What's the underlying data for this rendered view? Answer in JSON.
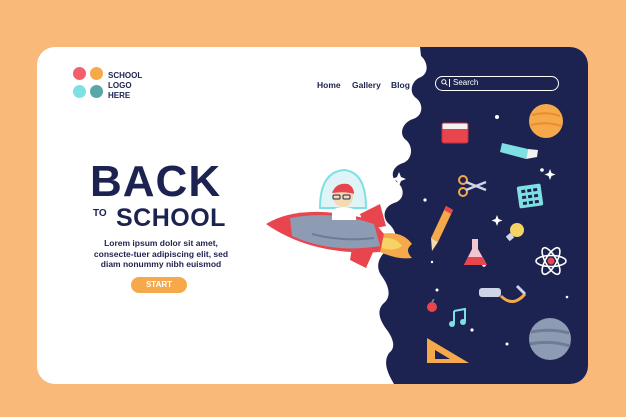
{
  "logo": {
    "text": "SCHOOL\nLOGO\nHERE",
    "colors": [
      "#f0616d",
      "#f6a94a",
      "#7ee0e3",
      "#5aa6a8"
    ]
  },
  "nav": {
    "items": [
      "Home",
      "Gallery",
      "Blog"
    ]
  },
  "search": {
    "placeholder": "Search"
  },
  "hero": {
    "title_big": "BACK",
    "title_small": "TO",
    "title_school": "SCHOOL",
    "body": "Lorem ipsum dolor sit amet, consecte-tuer adipiscing elit, sed diam nonummy nibh euismod",
    "cta": "START"
  },
  "colors": {
    "navy": "#1d2350",
    "accent": "#f6a94a",
    "background": "#f9b978",
    "rocket": "#e9454f"
  }
}
